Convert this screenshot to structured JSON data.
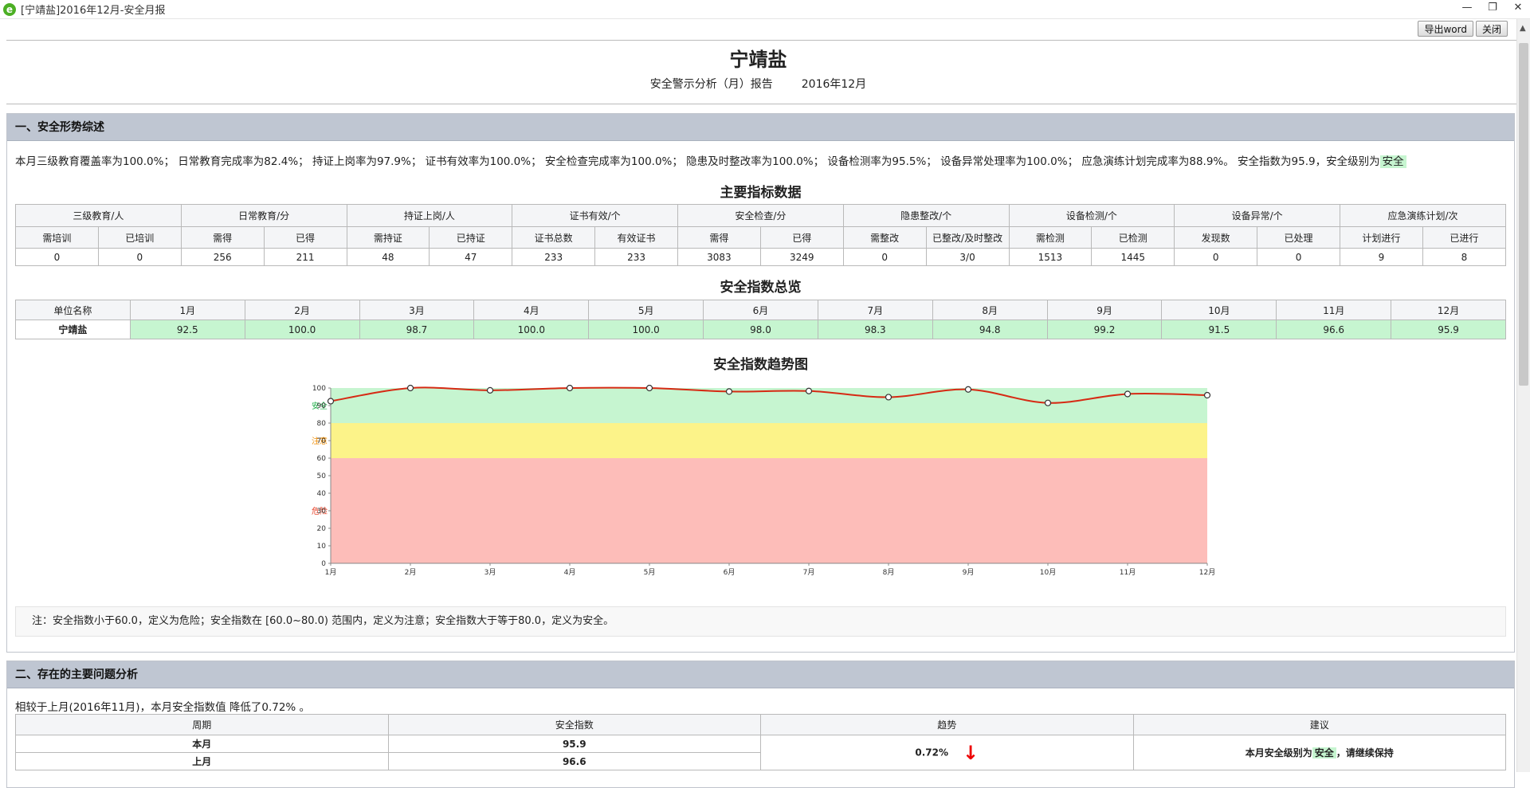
{
  "window": {
    "title": "[宁靖盐]2016年12月-安全月报",
    "minimize": "—",
    "restore": "❐",
    "close": "✕"
  },
  "toolbar": {
    "export_label": "导出word",
    "close_label": "关闭"
  },
  "header": {
    "title": "宁靖盐",
    "subtitle": "安全警示分析（月）报告",
    "period": "2016年12月"
  },
  "section1": {
    "heading": "一、安全形势综述",
    "summary": "本月三级教育覆盖率为100.0%； 日常教育完成率为82.4%； 持证上岗率为97.9%； 证书有效率为100.0%； 安全检查完成率为100.0%； 隐患及时整改率为100.0%； 设备检测率为95.5%； 设备异常处理率为100.0%； 应急演练计划完成率为88.9%。 安全指数为95.9，安全级别为",
    "level": "安全",
    "indicators": {
      "title": "主要指标数据",
      "groups": [
        "三级教育/人",
        "日常教育/分",
        "持证上岗/人",
        "证书有效/个",
        "安全检查/分",
        "隐患整改/个",
        "设备检测/个",
        "设备异常/个",
        "应急演练计划/次"
      ],
      "subheaders": [
        "需培训",
        "已培训",
        "需得",
        "已得",
        "需持证",
        "已持证",
        "证书总数",
        "有效证书",
        "需得",
        "已得",
        "需整改",
        "已整改/及时整改",
        "需检测",
        "已检测",
        "发现数",
        "已处理",
        "计划进行",
        "已进行"
      ],
      "values": [
        "0",
        "0",
        "256",
        "211",
        "48",
        "47",
        "233",
        "233",
        "3083",
        "3249",
        "0",
        "3/0",
        "1513",
        "1445",
        "0",
        "0",
        "9",
        "8"
      ]
    },
    "overview": {
      "title": "安全指数总览",
      "unit_header": "单位名称",
      "months": [
        "1月",
        "2月",
        "3月",
        "4月",
        "5月",
        "6月",
        "7月",
        "8月",
        "9月",
        "10月",
        "11月",
        "12月"
      ],
      "unit": "宁靖盐",
      "values": [
        "92.5",
        "100.0",
        "98.7",
        "100.0",
        "100.0",
        "98.0",
        "98.3",
        "94.8",
        "99.2",
        "91.5",
        "96.6",
        "95.9"
      ]
    },
    "note": "注：安全指数小于60.0，定义为危险；安全指数在 [60.0~80.0) 范围内，定义为注意；安全指数大于等于80.0，定义为安全。"
  },
  "chart_data": {
    "type": "line",
    "title": "安全指数趋势图",
    "categories": [
      "1月",
      "2月",
      "3月",
      "4月",
      "5月",
      "6月",
      "7月",
      "8月",
      "9月",
      "10月",
      "11月",
      "12月"
    ],
    "series": [
      {
        "values": [
          92.5,
          100.0,
          98.7,
          100.0,
          100.0,
          98.0,
          98.3,
          94.8,
          99.2,
          91.5,
          96.6,
          95.9
        ]
      }
    ],
    "ylim": [
      0,
      100
    ],
    "yticks": [
      0,
      10,
      20,
      30,
      40,
      50,
      60,
      70,
      80,
      90,
      100
    ],
    "bands": [
      {
        "label": "危险",
        "from": 0,
        "to": 60,
        "color": "#fdbdb9",
        "label_color": "#e8452c"
      },
      {
        "label": "注意",
        "from": 60,
        "to": 80,
        "color": "#fcf389",
        "label_color": "#f08c00"
      },
      {
        "label": "安全",
        "from": 80,
        "to": 100,
        "color": "#c6f5d0",
        "label_color": "#22b04b"
      }
    ],
    "line_color": "#d62a14",
    "grid": false
  },
  "section2": {
    "heading": "二、存在的主要问题分析",
    "compare": "相较于上月(2016年11月)，本月安全指数值 降低了0.72% 。",
    "headers": [
      "周期",
      "安全指数",
      "趋势",
      "建议"
    ],
    "rows": [
      {
        "period": "本月",
        "index": "95.9"
      },
      {
        "period": "上月",
        "index": "96.6"
      }
    ],
    "trend": "0.72%",
    "trend_arrow": "↓",
    "advice_prefix": "本月安全级别为",
    "advice_level": "安全",
    "advice_suffix": "，请继续保持"
  }
}
